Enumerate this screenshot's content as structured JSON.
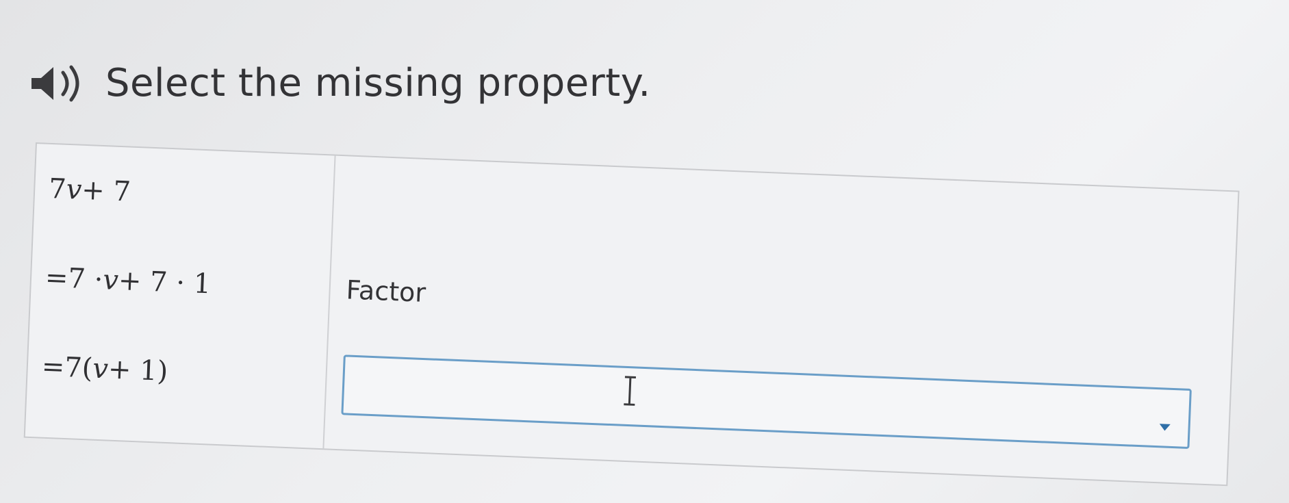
{
  "prompt": {
    "audio_icon": "speaker-icon",
    "text": "Select the missing property."
  },
  "steps": [
    {
      "lead": "",
      "coeff": "7",
      "var": "v",
      "rest": " + 7",
      "reason": ""
    },
    {
      "lead": "= ",
      "coeff": "7 · ",
      "var": "v",
      "rest": " + 7 · 1",
      "reason": "Factor"
    },
    {
      "lead": "= ",
      "coeff": "7(",
      "var": "v",
      "rest": " + 1)",
      "reason": ""
    }
  ],
  "dropdown": {
    "selected": "",
    "caret_icon": "chevron-down-icon",
    "cursor_icon": "text-cursor-icon"
  },
  "colors": {
    "accent": "#6a9ec8",
    "caret": "#2f6fa8",
    "background": "#eeeff1"
  }
}
